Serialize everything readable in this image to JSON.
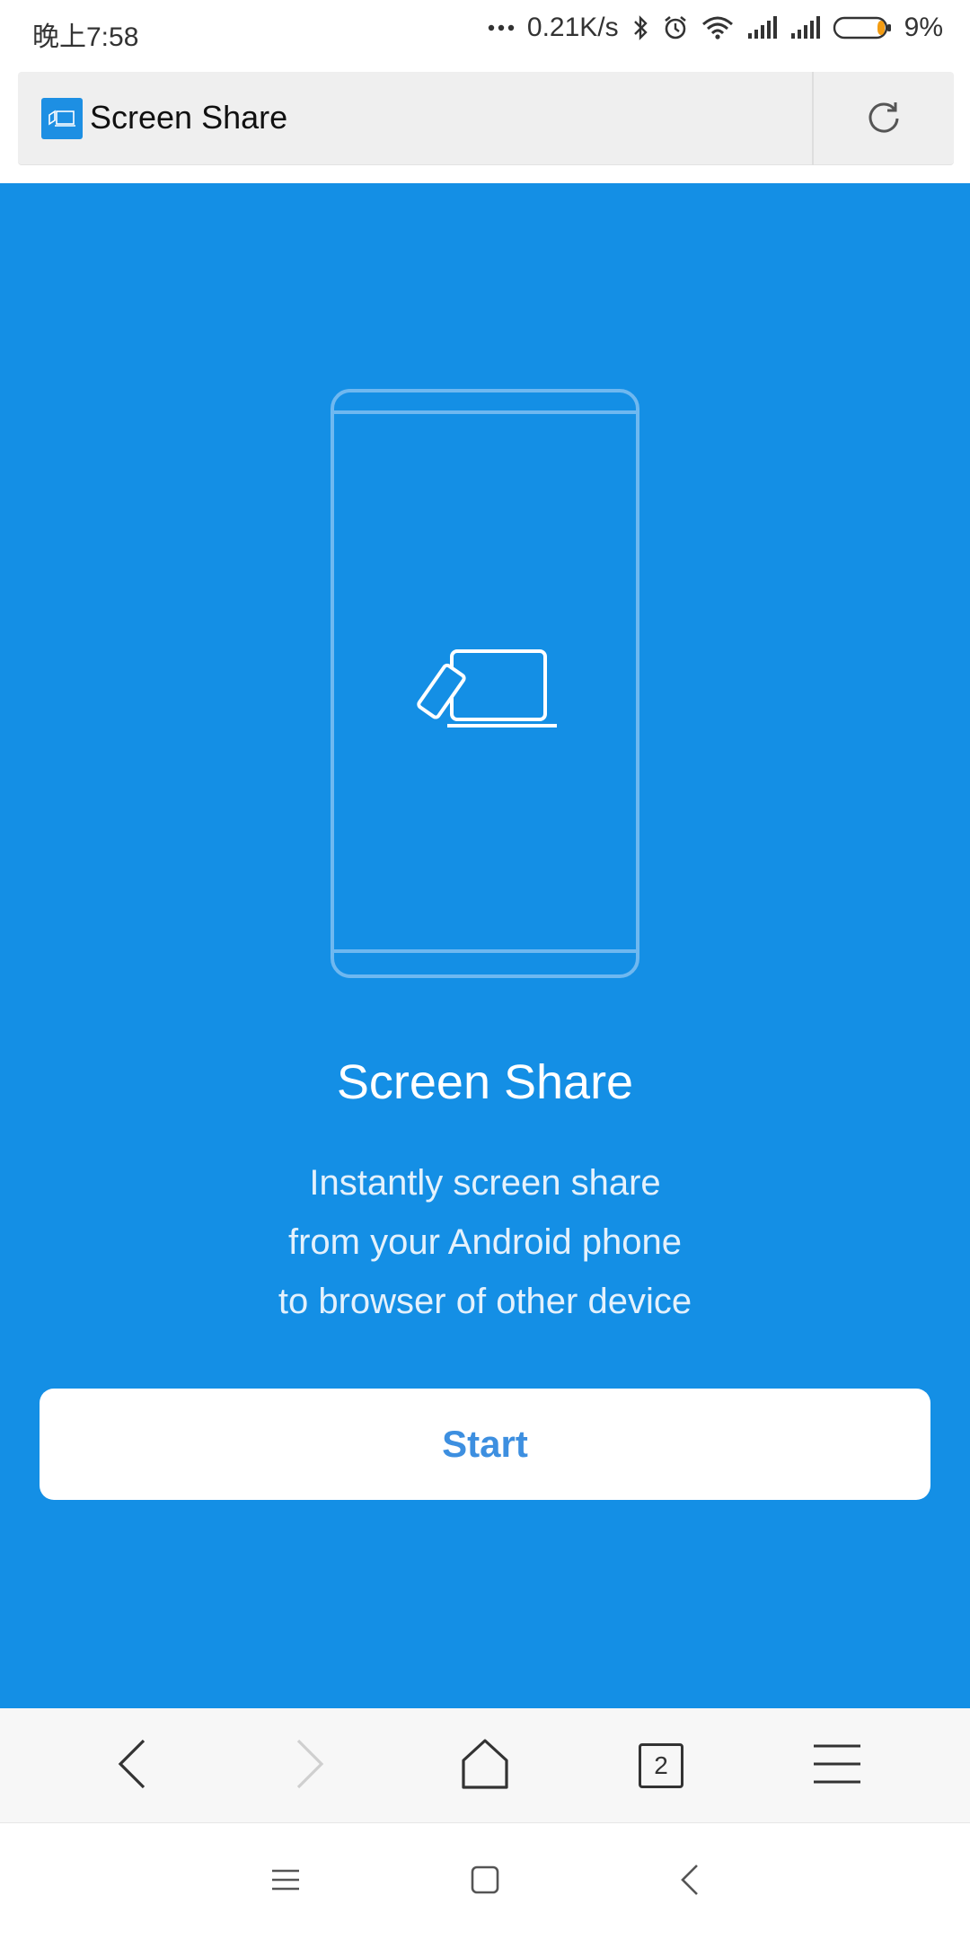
{
  "status_bar": {
    "time": "晚上7:58",
    "network_speed": "0.21K/s",
    "battery_percent": "9%",
    "battery_level": 0.09,
    "battery_color": "#f39c12"
  },
  "address_bar": {
    "page_title": "Screen Share"
  },
  "content": {
    "title": "Screen Share",
    "description_lines": [
      "Instantly screen share",
      "from your Android phone",
      "to browser of other device"
    ],
    "start_label": "Start"
  },
  "toolbar": {
    "tab_count": "2"
  },
  "colors": {
    "main_background": "#148fe5",
    "button_text": "#3d8fe0",
    "favicon": "#1d8fe3"
  }
}
